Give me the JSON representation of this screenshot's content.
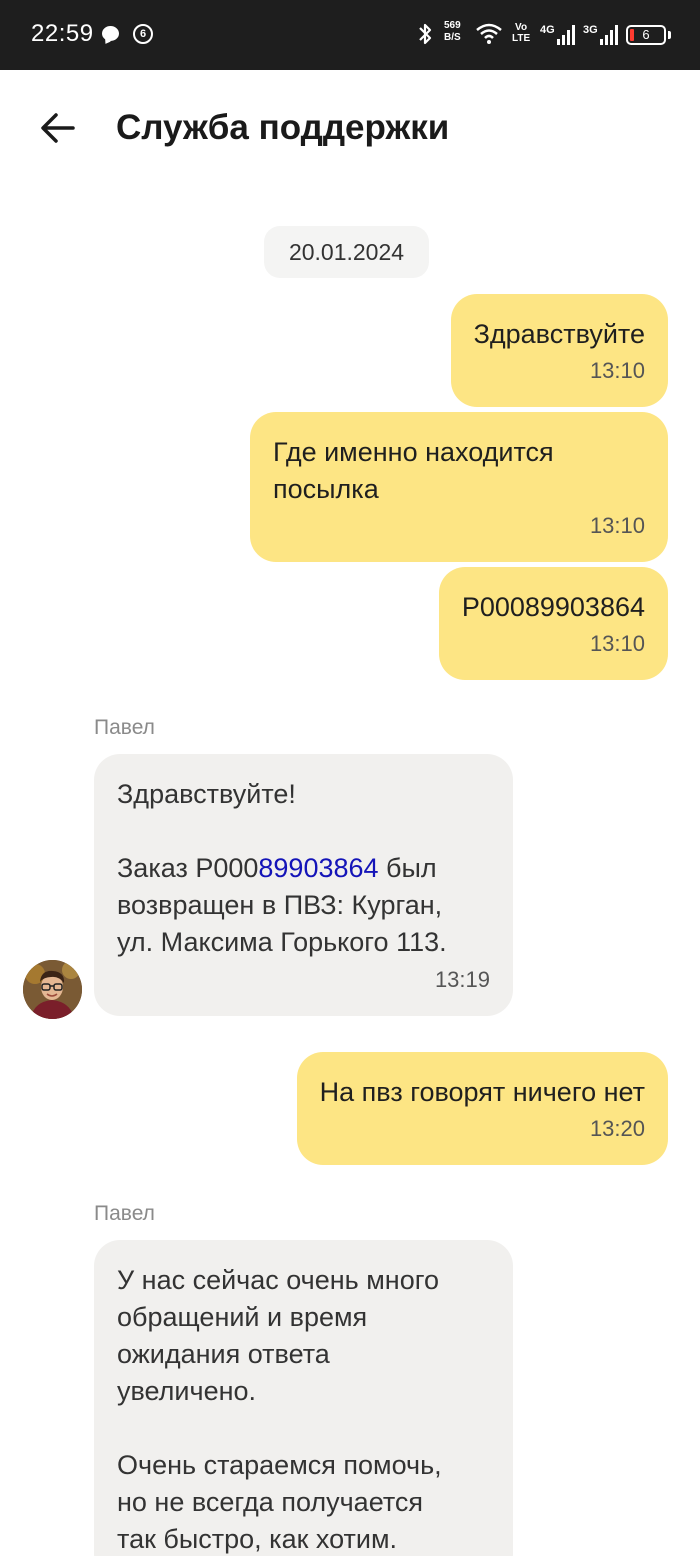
{
  "status_bar": {
    "time": "22:59",
    "notif_count": "6",
    "net_speed_value": "569",
    "net_speed_unit": "B/S",
    "volte_top": "Vo",
    "volte_bottom": "LTE",
    "net1": "4G",
    "net2": "3G",
    "battery_level": "6",
    "icons": [
      "chat-icon",
      "bluetooth-icon",
      "wifi-icon",
      "signal-icon",
      "battery-icon"
    ]
  },
  "header": {
    "title": "Служба поддержки",
    "back_icon": "arrow-left-icon"
  },
  "chat": {
    "date": "20.01.2024",
    "messages": [
      {
        "dir": "out",
        "text": "Здравствуйте",
        "time": "13:10"
      },
      {
        "dir": "out",
        "text": "Где именно находится\nпосылка",
        "time": "13:10"
      },
      {
        "dir": "out",
        "text": "P00089903864",
        "time": "13:10"
      },
      {
        "dir": "in",
        "sender": "Павел",
        "greeting": "Здравствуйте!",
        "order_prefix": "Заказ P000",
        "order_link": "89903864",
        "order_suffix": " был\nвозвращен в ПВЗ: Курган,\nул. Максима Горького 113.",
        "time": "13:19"
      },
      {
        "dir": "out",
        "text": "На пвз говорят ничего нет",
        "time": "13:20"
      },
      {
        "dir": "in",
        "sender": "Павел",
        "text": "У нас сейчас очень много\nобращений и время\nожидания ответа\nувеличено.\n\nОчень стараемся помочь,\nно не всегда получается\nтак быстро, как хотим."
      }
    ]
  },
  "colors": {
    "outgoing_bubble": "#fde584",
    "incoming_bubble": "#f1f0ee",
    "link": "#1414b8",
    "status_bar_bg": "#1e1e1e"
  }
}
